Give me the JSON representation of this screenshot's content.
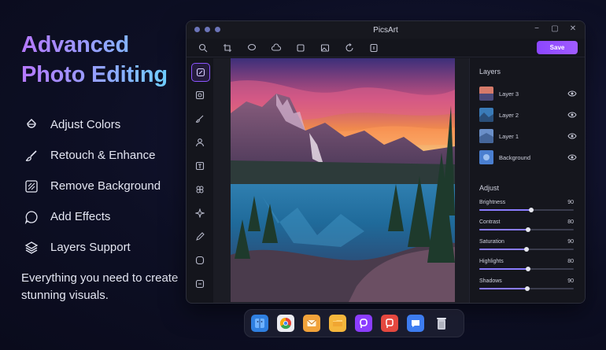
{
  "hero": {
    "line1": "Advanced",
    "line2": "Photo Editing"
  },
  "features": [
    {
      "label": "Adjust Colors",
      "icon": "palette-icon"
    },
    {
      "label": "Retouch & Enhance",
      "icon": "brush-icon"
    },
    {
      "label": "Remove Background",
      "icon": "remove-bg-icon"
    },
    {
      "label": "Add Effects",
      "icon": "effects-bubble-icon"
    },
    {
      "label": "Layers Support",
      "icon": "layers-icon"
    }
  ],
  "tagline": "Everything you need to create stunning visuals.",
  "window": {
    "title": "PicsArt",
    "controls": [
      "minimize",
      "maximize",
      "close"
    ],
    "save_label": "Save",
    "toolbar_icons": [
      "search-icon",
      "crop-icon",
      "lasso-icon",
      "cloud-icon",
      "frame-icon",
      "image-icon",
      "rotate-icon",
      "export-icon"
    ],
    "sidebar_icons": [
      "edit-icon",
      "image-adjust-icon",
      "brush-icon",
      "person-icon",
      "text-icon",
      "sticker-icon",
      "effects-icon",
      "draw-icon",
      "shape-icon",
      "more-icon"
    ]
  },
  "layers": {
    "title": "Layers",
    "items": [
      {
        "name": "Layer 3"
      },
      {
        "name": "Layer 2"
      },
      {
        "name": "Layer 1"
      },
      {
        "name": "Background"
      }
    ]
  },
  "adjust": {
    "title": "Adjust",
    "items": [
      {
        "label": "Brightness",
        "value": "90",
        "level": 0.55
      },
      {
        "label": "Contrast",
        "value": "80",
        "level": 0.52
      },
      {
        "label": "Saturation",
        "value": "90",
        "level": 0.5
      },
      {
        "label": "Highlights",
        "value": "80",
        "level": 0.52
      },
      {
        "label": "Shadows",
        "value": "90",
        "level": 0.51
      }
    ]
  },
  "dock": [
    "finder-icon",
    "chrome-icon",
    "mail-icon",
    "folder-icon",
    "picsart-icon",
    "picsart-red-icon",
    "chat-icon",
    "trash-icon"
  ],
  "colors": {
    "accent": "#8b46ff",
    "hero_gradient_start": "#b678ff",
    "hero_gradient_end": "#6fd0ff"
  }
}
